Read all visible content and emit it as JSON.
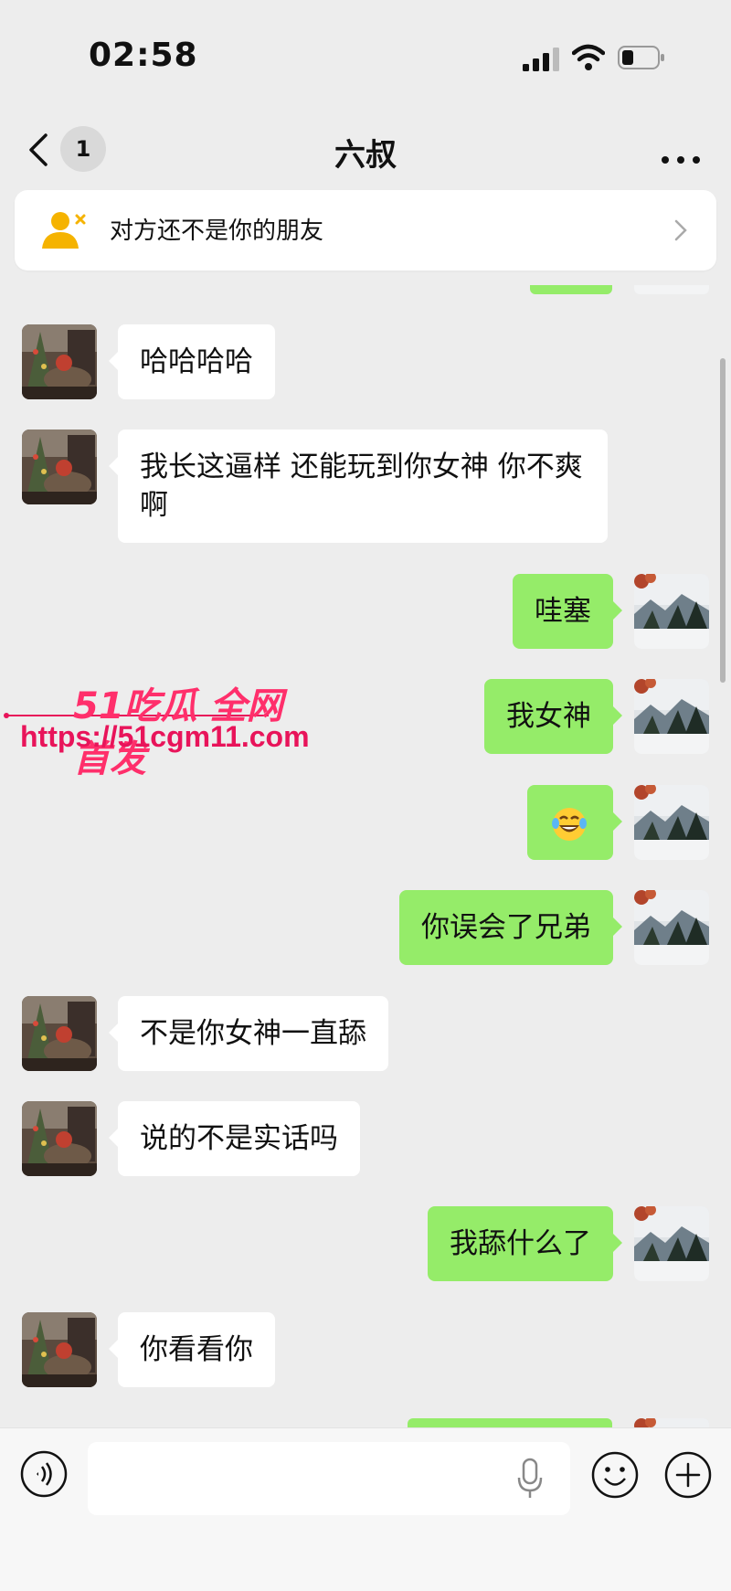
{
  "status_bar": {
    "time": "02:58"
  },
  "nav": {
    "unread_count": "1",
    "title": "六叔"
  },
  "banner": {
    "text": "对方还不是你的朋友"
  },
  "messages": [
    {
      "side": "left",
      "text": "哈哈哈哈"
    },
    {
      "side": "left",
      "text": "我长这逼样 还能玩到你女神 你不爽啊"
    },
    {
      "side": "right",
      "text": "哇塞"
    },
    {
      "side": "right",
      "text": "我女神"
    },
    {
      "side": "right",
      "emoji": "face-with-tears-of-joy"
    },
    {
      "side": "right",
      "text": "你误会了兄弟"
    },
    {
      "side": "left",
      "text": "不是你女神一直舔"
    },
    {
      "side": "left",
      "text": "说的不是实话吗"
    },
    {
      "side": "right",
      "text": "我舔什么了"
    },
    {
      "side": "left",
      "text": "你看看你"
    }
  ],
  "watermark": {
    "brand": "51吃瓜 全网首发",
    "url": "https://51cgm11.com"
  },
  "input": {
    "value": "",
    "placeholder": ""
  },
  "icons": [
    "back-arrow-icon",
    "more-icon",
    "add-friend-icon",
    "chevron-right-icon",
    "voice-icon",
    "mic-icon",
    "emoji-icon",
    "plus-icon"
  ],
  "colors": {
    "sent_bubble": "#95ec69",
    "received_bubble": "#ffffff",
    "background": "#ededed",
    "banner_icon": "#f5b300"
  }
}
